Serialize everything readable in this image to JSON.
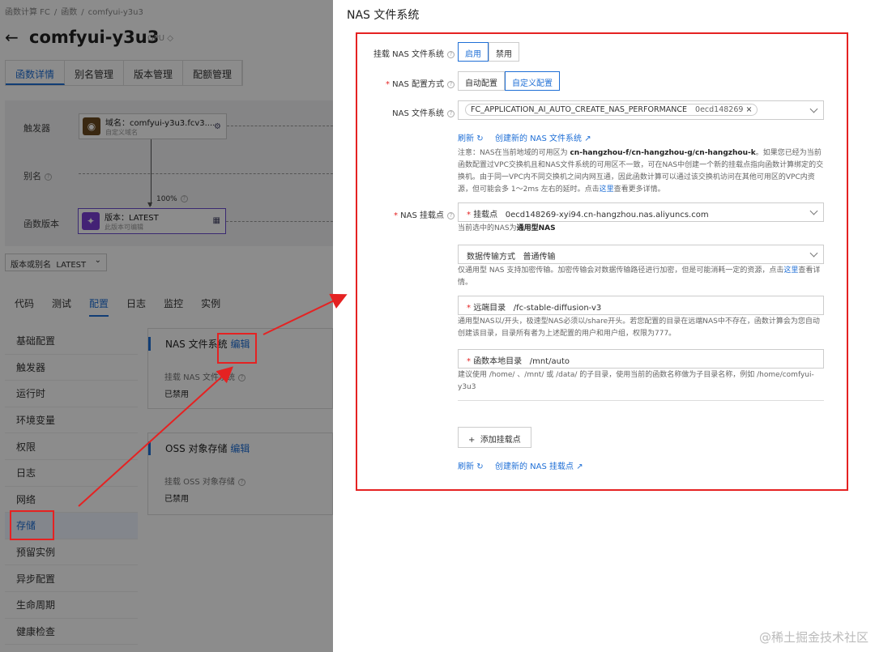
{
  "breadcrumb": [
    "函数计算 FC",
    "函数",
    "comfyui-y3u3"
  ],
  "page": {
    "title": "comfyui-y3u3",
    "gpu_tag": "GPU"
  },
  "top_tabs": [
    {
      "label": "函数详情",
      "active": true
    },
    {
      "label": "别名管理"
    },
    {
      "label": "版本管理"
    },
    {
      "label": "配额管理"
    }
  ],
  "flow": {
    "trigger_label": "触发器",
    "alias_label": "别名",
    "version_label": "函数版本",
    "domain_card": {
      "title": "域名：comfyui-y3u3.fcv3....",
      "subtitle": "自定义域名"
    },
    "version_card": {
      "title": "版本：LATEST",
      "subtitle": "此版本可编辑"
    },
    "percent": "100%"
  },
  "version_select": {
    "label": "版本或别名",
    "value": "LATEST"
  },
  "sub_tabs": [
    {
      "label": "代码"
    },
    {
      "label": "测试"
    },
    {
      "label": "配置",
      "active": true
    },
    {
      "label": "日志"
    },
    {
      "label": "监控"
    },
    {
      "label": "实例"
    }
  ],
  "side_nav": [
    {
      "label": "基础配置"
    },
    {
      "label": "触发器"
    },
    {
      "label": "运行时"
    },
    {
      "label": "环境变量"
    },
    {
      "label": "权限"
    },
    {
      "label": "日志"
    },
    {
      "label": "网络"
    },
    {
      "label": "存储",
      "active": true
    },
    {
      "label": "预留实例"
    },
    {
      "label": "异步配置"
    },
    {
      "label": "生命周期"
    },
    {
      "label": "健康检查"
    }
  ],
  "nas_panel": {
    "title": "NAS 文件系统",
    "edit": "编辑",
    "key": "挂载 NAS 文件系统",
    "value": "已禁用"
  },
  "oss_panel": {
    "title": "OSS 对象存储",
    "edit": "编辑",
    "key": "挂载 OSS 对象存储",
    "value": "已禁用"
  },
  "drawer": {
    "title": "NAS 文件系统",
    "mount_label": "挂载 NAS 文件系统",
    "enable": "启用",
    "disable": "禁用",
    "config_label": "NAS 配置方式",
    "auto_config": "自动配置",
    "custom_config": "自定义配置",
    "fs_label": "NAS 文件系统",
    "fs_tag_name": "FC_APPLICATION_AI_AUTO_CREATE_NAS_PERFORMANCE",
    "fs_tag_id": "0ecd148269",
    "refresh": "刷新",
    "create_fs": "创建新的 NAS 文件系统",
    "note_pre": "注意：NAS在当前地域的可用区为 ",
    "note_zones": "cn-hangzhou-f/cn-hangzhou-g/cn-hangzhou-k",
    "note_mid": "。如果您已经为当前函数配置过VPC交换机且和NAS文件系统的可用区不一致，可在NAS中创建一个新的挂载点指向函数计算绑定的交换机。由于同一VPC内不同交换机之间内网互通，因此函数计算可以通过该交换机访问在其他可用区的VPC内资源，但可能会多 1～2ms 左右的延时。点击",
    "note_link": "这里",
    "note_post": "查看更多详情。",
    "mount_point_label": "NAS 挂载点",
    "mount_point_key": "挂载点",
    "mount_point_value": "0ecd148269-xyi94.cn-hangzhou.nas.aliyuncs.com",
    "nas_type_pre": "当前选中的NAS为",
    "nas_type": "通用型NAS",
    "transfer_key": "数据传输方式",
    "transfer_value": "普通传输",
    "transfer_note_pre": "仅通用型 NAS 支持加密传输。加密传输会对数据传输路径进行加密，但是可能消耗一定的资源，点击",
    "transfer_note_link": "这里",
    "transfer_note_post": "查看详情。",
    "remote_key": "远端目录",
    "remote_value": "/fc-stable-diffusion-v3",
    "remote_note": "通用型NAS以/开头，极速型NAS必须以/share开头。若您配置的目录在远端NAS中不存在，函数计算会为您自动创建该目录，目录所有者为上述配置的用户和用户组，权限为777。",
    "local_key": "函数本地目录",
    "local_value": "/mnt/auto",
    "local_note": "建议使用 /home/ 、/mnt/ 或 /data/ 的子目录，使用当前的函数名称做为子目录名称，例如 /home/comfyui-y3u3",
    "add_mount": "添加挂载点",
    "refresh2": "刷新",
    "create_mount": "创建新的 NAS 挂载点"
  },
  "watermark": "@稀土掘金技术社区",
  "colors": {
    "accent": "#1f6fd6",
    "highlight": "#e52222"
  }
}
